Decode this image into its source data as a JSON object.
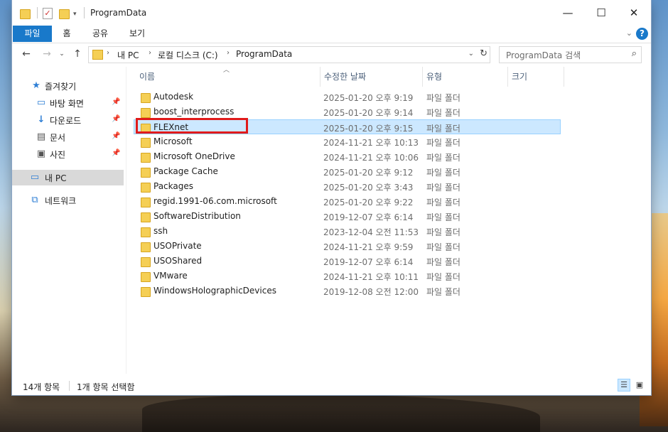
{
  "window": {
    "title": "ProgramData"
  },
  "controls": {
    "minimize": "—",
    "maximize": "☐",
    "close": "✕"
  },
  "ribbon": {
    "tabs": [
      "파일",
      "홈",
      "공유",
      "보기"
    ],
    "help": "?"
  },
  "address": {
    "crumbs": [
      "내 PC",
      "로컬 디스크 (C:)",
      "ProgramData"
    ],
    "search_placeholder": "ProgramData 검색"
  },
  "nav": {
    "items": [
      {
        "label": "즐겨찾기",
        "icon": "star-icon",
        "pinned": false
      },
      {
        "label": "바탕 화면",
        "icon": "desktop-icon",
        "pinned": true
      },
      {
        "label": "다운로드",
        "icon": "download-icon",
        "pinned": true
      },
      {
        "label": "문서",
        "icon": "document-icon",
        "pinned": true
      },
      {
        "label": "사진",
        "icon": "pictures-icon",
        "pinned": true
      },
      {
        "label": "내 PC",
        "icon": "pc-icon",
        "pinned": false,
        "selected": true
      },
      {
        "label": "네트워크",
        "icon": "network-icon",
        "pinned": false
      }
    ]
  },
  "columns": [
    "이름",
    "수정한 날짜",
    "유형",
    "크기"
  ],
  "files": [
    {
      "name": "Autodesk",
      "date": "2025-01-20 오후 9:19",
      "type": "파일 폴더"
    },
    {
      "name": "boost_interprocess",
      "date": "2025-01-20 오후 9:14",
      "type": "파일 폴더"
    },
    {
      "name": "FLEXnet",
      "date": "2025-01-20 오후 9:15",
      "type": "파일 폴더",
      "selected": true
    },
    {
      "name": "Microsoft",
      "date": "2024-11-21 오후 10:13",
      "type": "파일 폴더"
    },
    {
      "name": "Microsoft OneDrive",
      "date": "2024-11-21 오후 10:06",
      "type": "파일 폴더"
    },
    {
      "name": "Package Cache",
      "date": "2025-01-20 오후 9:12",
      "type": "파일 폴더"
    },
    {
      "name": "Packages",
      "date": "2025-01-20 오후 3:43",
      "type": "파일 폴더"
    },
    {
      "name": "regid.1991-06.com.microsoft",
      "date": "2025-01-20 오후 9:22",
      "type": "파일 폴더"
    },
    {
      "name": "SoftwareDistribution",
      "date": "2019-12-07 오후 6:14",
      "type": "파일 폴더"
    },
    {
      "name": "ssh",
      "date": "2023-12-04 오전 11:53",
      "type": "파일 폴더"
    },
    {
      "name": "USOPrivate",
      "date": "2024-11-21 오후 9:59",
      "type": "파일 폴더"
    },
    {
      "name": "USOShared",
      "date": "2019-12-07 오후 6:14",
      "type": "파일 폴더"
    },
    {
      "name": "VMware",
      "date": "2024-11-21 오후 10:11",
      "type": "파일 폴더"
    },
    {
      "name": "WindowsHolographicDevices",
      "date": "2019-12-08 오전 12:00",
      "type": "파일 폴더"
    }
  ],
  "status": {
    "count": "14개 항목",
    "selection": "1개 항목 선택함"
  },
  "colors": {
    "accent": "#1979ca",
    "selection": "#cce8ff",
    "highlight": "#e01b1b",
    "folder": "#f5cf55"
  }
}
